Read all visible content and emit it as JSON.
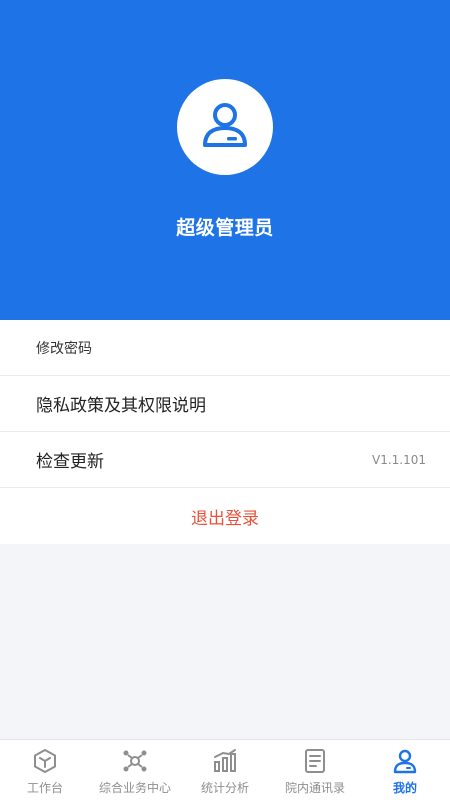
{
  "profile": {
    "name": "超级管理员",
    "avatar_icon": "user-icon"
  },
  "menu": {
    "change_password": "修改密码",
    "privacy_policy": "隐私政策及其权限说明",
    "check_update": "检查更新",
    "version": "V1.1.101",
    "logout": "退出登录"
  },
  "tabbar": {
    "tabs": [
      {
        "label": "工作台",
        "icon": "cube-icon"
      },
      {
        "label": "综合业务中心",
        "icon": "network-icon"
      },
      {
        "label": "统计分析",
        "icon": "bar-chart-icon"
      },
      {
        "label": "院内通讯录",
        "icon": "book-icon"
      },
      {
        "label": "我的",
        "icon": "user-icon"
      }
    ],
    "active_index": 4
  },
  "colors": {
    "primary": "#1e73e6",
    "danger": "#e8523a",
    "inactive": "#8e8e8e"
  }
}
